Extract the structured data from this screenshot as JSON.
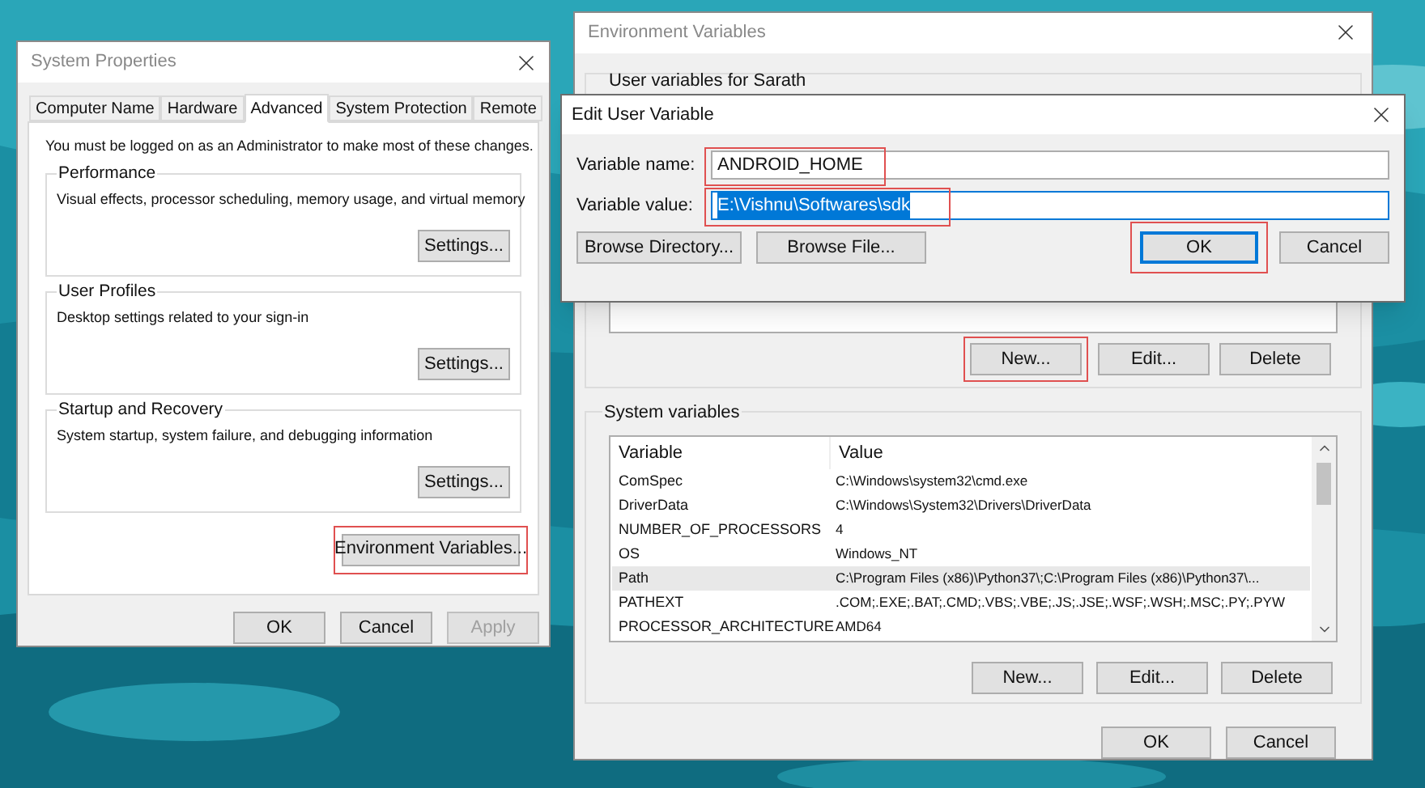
{
  "system_properties": {
    "title": "System Properties",
    "tabs": [
      {
        "label": "Computer Name",
        "selected": false
      },
      {
        "label": "Hardware",
        "selected": false
      },
      {
        "label": "Advanced",
        "selected": true
      },
      {
        "label": "System Protection",
        "selected": false
      },
      {
        "label": "Remote",
        "selected": false
      }
    ],
    "notice": "You must be logged on as an Administrator to make most of these changes.",
    "groups": [
      {
        "title": "Performance",
        "description": "Visual effects, processor scheduling, memory usage, and virtual memory",
        "button": "Settings..."
      },
      {
        "title": "User Profiles",
        "description": "Desktop settings related to your sign-in",
        "button": "Settings..."
      },
      {
        "title": "Startup and Recovery",
        "description": "System startup, system failure, and debugging information",
        "button": "Settings..."
      }
    ],
    "env_button": {
      "label": "Environment Variables...",
      "highlighted": true
    },
    "buttons": [
      {
        "label": "OK",
        "disabled": false
      },
      {
        "label": "Cancel",
        "disabled": false
      },
      {
        "label": "Apply",
        "disabled": true
      }
    ]
  },
  "environment_variables": {
    "title": "Environment Variables",
    "user_section": "User variables for Sarath",
    "user_buttons": [
      {
        "label": "New...",
        "highlighted": true
      },
      {
        "label": "Edit...",
        "highlighted": false
      },
      {
        "label": "Delete",
        "highlighted": false
      }
    ],
    "system_section": "System variables",
    "table": {
      "columns": [
        "Variable",
        "Value"
      ],
      "rows": [
        {
          "variable": "ComSpec",
          "value": "C:\\Windows\\system32\\cmd.exe",
          "selected": false
        },
        {
          "variable": "DriverData",
          "value": "C:\\Windows\\System32\\Drivers\\DriverData",
          "selected": false
        },
        {
          "variable": "NUMBER_OF_PROCESSORS",
          "value": "4",
          "selected": false
        },
        {
          "variable": "OS",
          "value": "Windows_NT",
          "selected": false
        },
        {
          "variable": "Path",
          "value": "C:\\Program Files (x86)\\Python37\\;C:\\Program Files (x86)\\Python37\\...",
          "selected": true
        },
        {
          "variable": "PATHEXT",
          "value": ".COM;.EXE;.BAT;.CMD;.VBS;.VBE;.JS;.JSE;.WSF;.WSH;.MSC;.PY;.PYW",
          "selected": false
        },
        {
          "variable": "PROCESSOR_ARCHITECTURE",
          "value": "AMD64",
          "selected": false
        }
      ]
    },
    "system_buttons": [
      "New...",
      "Edit...",
      "Delete"
    ],
    "buttons": [
      "OK",
      "Cancel"
    ]
  },
  "edit_user_variable": {
    "title": "Edit User Variable",
    "fields": [
      {
        "label": "Variable name:",
        "value": "ANDROID_HOME",
        "text_selected": false,
        "highlighted": true
      },
      {
        "label": "Variable value:",
        "value": "E:\\Vishnu\\Softwares\\sdk",
        "text_selected": true,
        "highlighted": true
      }
    ],
    "left_buttons": [
      {
        "label": "Browse Directory...",
        "highlighted": false,
        "default": false
      },
      {
        "label": "Browse File...",
        "highlighted": false,
        "default": false
      }
    ],
    "right_buttons": [
      {
        "label": "OK",
        "highlighted": true,
        "default": true
      },
      {
        "label": "Cancel",
        "highlighted": false,
        "default": false
      }
    ]
  }
}
